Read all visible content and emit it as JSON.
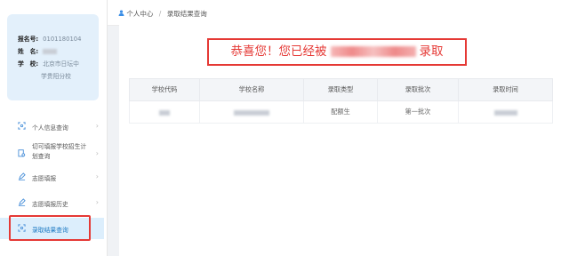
{
  "profile": {
    "id_label": "报名号:",
    "id_value": "0101180104",
    "name_label": "姓　名:",
    "school_label": "学　校:",
    "school_line1": "北京市日坛中",
    "school_line2": "学贵阳分校"
  },
  "menu": [
    {
      "label": "个人信息查询",
      "icon": "id-card-icon"
    },
    {
      "label": "切可填报学校招生计划查询",
      "icon": "document-search-icon"
    },
    {
      "label": "志愿填报",
      "icon": "pencil-icon"
    },
    {
      "label": "志愿填报历史",
      "icon": "pencil-history-icon"
    },
    {
      "label": "录取结果查询",
      "icon": "result-search-icon"
    }
  ],
  "breadcrumb": {
    "home": "个人中心",
    "separator": "/",
    "current": "录取结果查询"
  },
  "banner": {
    "prefix": "恭喜您！您已经被",
    "suffix": "录取"
  },
  "table": {
    "headers": [
      "学校代码",
      "学校名称",
      "录取类型",
      "录取批次",
      "录取时间"
    ],
    "row": {
      "type": "配额生",
      "batch": "第一批次"
    }
  },
  "colors": {
    "accent": "#1a78c2",
    "highlight": "#e53935",
    "profile_bg": "#e3f0fb"
  }
}
